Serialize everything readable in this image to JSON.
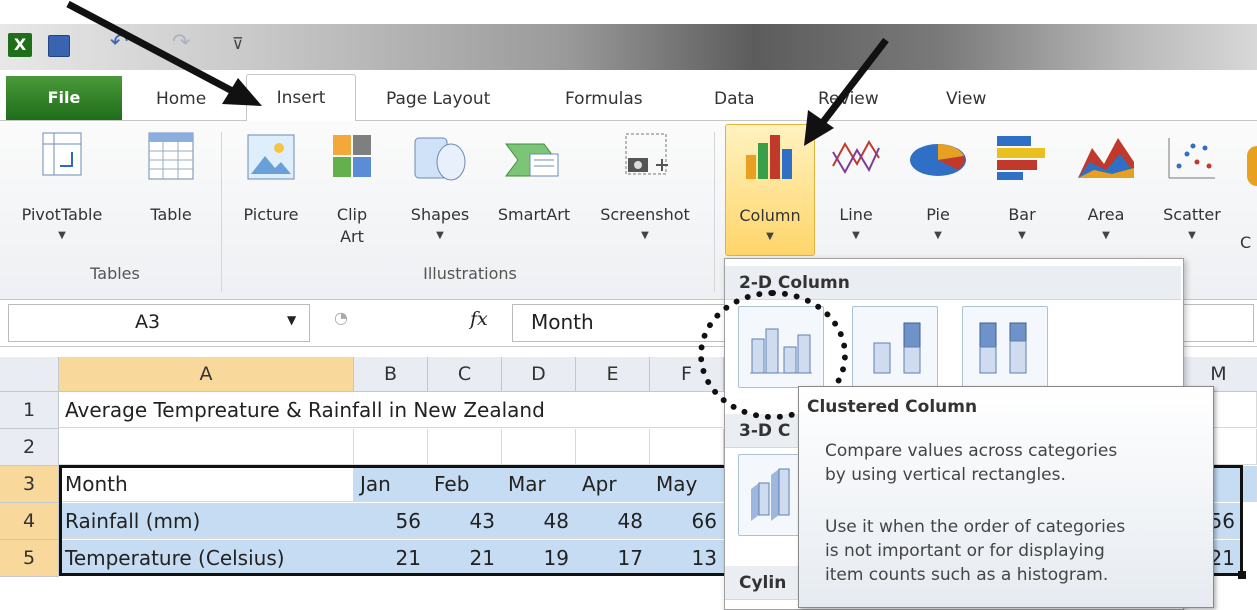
{
  "ribbon": {
    "tabs": [
      "File",
      "Home",
      "Insert",
      "Page Layout",
      "Formulas",
      "Data",
      "Review",
      "View"
    ],
    "tables": {
      "pivot_label": "PivotTable",
      "table_label": "Table",
      "group": "Tables"
    },
    "illustrations": {
      "picture": "Picture",
      "clip_1": "Clip",
      "clip_2": "Art",
      "shapes": "Shapes",
      "smartart": "SmartArt",
      "screenshot": "Screenshot",
      "group": "Illustrations"
    },
    "charts": {
      "column": "Column",
      "line": "Line",
      "pie": "Pie",
      "bar": "Bar",
      "area": "Area",
      "scatter": "Scatter",
      "other_partial": "C"
    }
  },
  "formula_bar": {
    "name_box": "A3",
    "fx": "fx",
    "value": "Month"
  },
  "columns": [
    "A",
    "B",
    "C",
    "D",
    "E",
    "F",
    "M"
  ],
  "rows": [
    "1",
    "2",
    "3",
    "4",
    "5"
  ],
  "sheet": {
    "title": "Average Tempreature & Rainfall in New Zealand",
    "months": [
      "Month",
      "Jan",
      "Feb",
      "Mar",
      "Apr",
      "May"
    ],
    "rainfall": [
      "Rainfall (mm)",
      "56",
      "43",
      "48",
      "48",
      "66"
    ],
    "temperature": [
      "Temperature (Celsius)",
      "21",
      "21",
      "19",
      "17",
      "13"
    ],
    "m_partial": [
      "56",
      "21"
    ]
  },
  "gallery": {
    "section_2d": "2-D Column",
    "section_3d": "3-D C",
    "section_cyl": "Cylin"
  },
  "tooltip": {
    "title": "Clustered Column",
    "line1": "Compare values across categories",
    "line2": "by using vertical rectangles.",
    "line3": "Use it when the order of categories",
    "line4": "is not important or for displaying",
    "line5": "item counts such as a histogram."
  },
  "colors": {
    "file_tab": "#2e7d27",
    "selection": "#c6dcf3",
    "highlight_header": "#f9d99b"
  }
}
